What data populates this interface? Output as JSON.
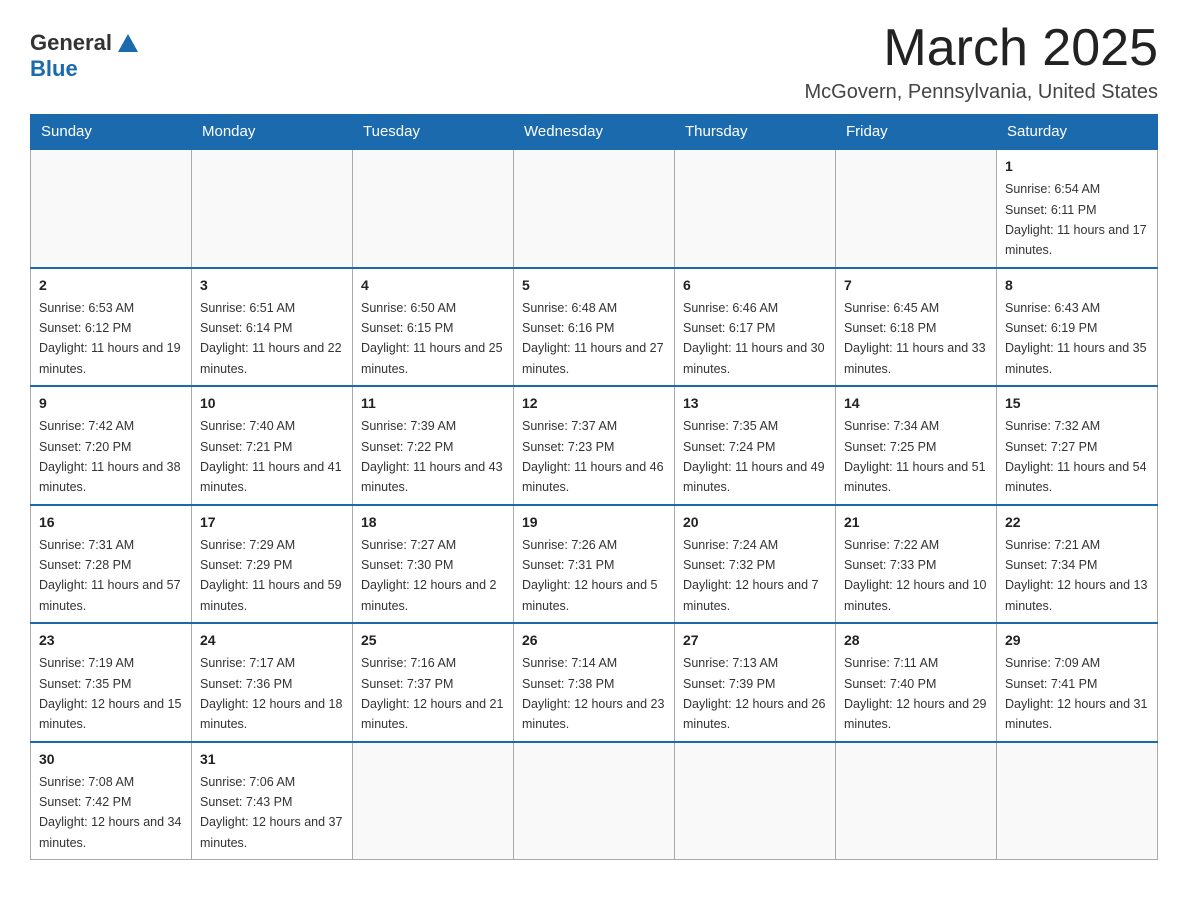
{
  "header": {
    "logo_general": "General",
    "logo_blue": "Blue",
    "month_title": "March 2025",
    "location": "McGovern, Pennsylvania, United States"
  },
  "days_of_week": [
    "Sunday",
    "Monday",
    "Tuesday",
    "Wednesday",
    "Thursday",
    "Friday",
    "Saturday"
  ],
  "weeks": [
    [
      {
        "day": null,
        "info": null
      },
      {
        "day": null,
        "info": null
      },
      {
        "day": null,
        "info": null
      },
      {
        "day": null,
        "info": null
      },
      {
        "day": null,
        "info": null
      },
      {
        "day": null,
        "info": null
      },
      {
        "day": "1",
        "info": "Sunrise: 6:54 AM\nSunset: 6:11 PM\nDaylight: 11 hours and 17 minutes."
      }
    ],
    [
      {
        "day": "2",
        "info": "Sunrise: 6:53 AM\nSunset: 6:12 PM\nDaylight: 11 hours and 19 minutes."
      },
      {
        "day": "3",
        "info": "Sunrise: 6:51 AM\nSunset: 6:14 PM\nDaylight: 11 hours and 22 minutes."
      },
      {
        "day": "4",
        "info": "Sunrise: 6:50 AM\nSunset: 6:15 PM\nDaylight: 11 hours and 25 minutes."
      },
      {
        "day": "5",
        "info": "Sunrise: 6:48 AM\nSunset: 6:16 PM\nDaylight: 11 hours and 27 minutes."
      },
      {
        "day": "6",
        "info": "Sunrise: 6:46 AM\nSunset: 6:17 PM\nDaylight: 11 hours and 30 minutes."
      },
      {
        "day": "7",
        "info": "Sunrise: 6:45 AM\nSunset: 6:18 PM\nDaylight: 11 hours and 33 minutes."
      },
      {
        "day": "8",
        "info": "Sunrise: 6:43 AM\nSunset: 6:19 PM\nDaylight: 11 hours and 35 minutes."
      }
    ],
    [
      {
        "day": "9",
        "info": "Sunrise: 7:42 AM\nSunset: 7:20 PM\nDaylight: 11 hours and 38 minutes."
      },
      {
        "day": "10",
        "info": "Sunrise: 7:40 AM\nSunset: 7:21 PM\nDaylight: 11 hours and 41 minutes."
      },
      {
        "day": "11",
        "info": "Sunrise: 7:39 AM\nSunset: 7:22 PM\nDaylight: 11 hours and 43 minutes."
      },
      {
        "day": "12",
        "info": "Sunrise: 7:37 AM\nSunset: 7:23 PM\nDaylight: 11 hours and 46 minutes."
      },
      {
        "day": "13",
        "info": "Sunrise: 7:35 AM\nSunset: 7:24 PM\nDaylight: 11 hours and 49 minutes."
      },
      {
        "day": "14",
        "info": "Sunrise: 7:34 AM\nSunset: 7:25 PM\nDaylight: 11 hours and 51 minutes."
      },
      {
        "day": "15",
        "info": "Sunrise: 7:32 AM\nSunset: 7:27 PM\nDaylight: 11 hours and 54 minutes."
      }
    ],
    [
      {
        "day": "16",
        "info": "Sunrise: 7:31 AM\nSunset: 7:28 PM\nDaylight: 11 hours and 57 minutes."
      },
      {
        "day": "17",
        "info": "Sunrise: 7:29 AM\nSunset: 7:29 PM\nDaylight: 11 hours and 59 minutes."
      },
      {
        "day": "18",
        "info": "Sunrise: 7:27 AM\nSunset: 7:30 PM\nDaylight: 12 hours and 2 minutes."
      },
      {
        "day": "19",
        "info": "Sunrise: 7:26 AM\nSunset: 7:31 PM\nDaylight: 12 hours and 5 minutes."
      },
      {
        "day": "20",
        "info": "Sunrise: 7:24 AM\nSunset: 7:32 PM\nDaylight: 12 hours and 7 minutes."
      },
      {
        "day": "21",
        "info": "Sunrise: 7:22 AM\nSunset: 7:33 PM\nDaylight: 12 hours and 10 minutes."
      },
      {
        "day": "22",
        "info": "Sunrise: 7:21 AM\nSunset: 7:34 PM\nDaylight: 12 hours and 13 minutes."
      }
    ],
    [
      {
        "day": "23",
        "info": "Sunrise: 7:19 AM\nSunset: 7:35 PM\nDaylight: 12 hours and 15 minutes."
      },
      {
        "day": "24",
        "info": "Sunrise: 7:17 AM\nSunset: 7:36 PM\nDaylight: 12 hours and 18 minutes."
      },
      {
        "day": "25",
        "info": "Sunrise: 7:16 AM\nSunset: 7:37 PM\nDaylight: 12 hours and 21 minutes."
      },
      {
        "day": "26",
        "info": "Sunrise: 7:14 AM\nSunset: 7:38 PM\nDaylight: 12 hours and 23 minutes."
      },
      {
        "day": "27",
        "info": "Sunrise: 7:13 AM\nSunset: 7:39 PM\nDaylight: 12 hours and 26 minutes."
      },
      {
        "day": "28",
        "info": "Sunrise: 7:11 AM\nSunset: 7:40 PM\nDaylight: 12 hours and 29 minutes."
      },
      {
        "day": "29",
        "info": "Sunrise: 7:09 AM\nSunset: 7:41 PM\nDaylight: 12 hours and 31 minutes."
      }
    ],
    [
      {
        "day": "30",
        "info": "Sunrise: 7:08 AM\nSunset: 7:42 PM\nDaylight: 12 hours and 34 minutes."
      },
      {
        "day": "31",
        "info": "Sunrise: 7:06 AM\nSunset: 7:43 PM\nDaylight: 12 hours and 37 minutes."
      },
      {
        "day": null,
        "info": null
      },
      {
        "day": null,
        "info": null
      },
      {
        "day": null,
        "info": null
      },
      {
        "day": null,
        "info": null
      },
      {
        "day": null,
        "info": null
      }
    ]
  ]
}
